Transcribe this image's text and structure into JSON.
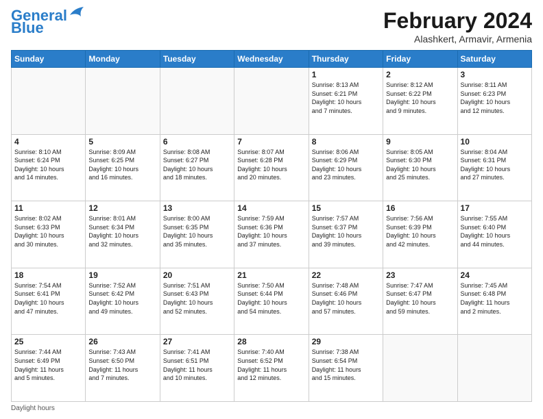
{
  "header": {
    "logo_line1": "General",
    "logo_line2": "Blue",
    "month_title": "February 2024",
    "location": "Alashkert, Armavir, Armenia"
  },
  "days_of_week": [
    "Sunday",
    "Monday",
    "Tuesday",
    "Wednesday",
    "Thursday",
    "Friday",
    "Saturday"
  ],
  "weeks": [
    [
      {
        "day": "",
        "info": ""
      },
      {
        "day": "",
        "info": ""
      },
      {
        "day": "",
        "info": ""
      },
      {
        "day": "",
        "info": ""
      },
      {
        "day": "1",
        "info": "Sunrise: 8:13 AM\nSunset: 6:21 PM\nDaylight: 10 hours\nand 7 minutes."
      },
      {
        "day": "2",
        "info": "Sunrise: 8:12 AM\nSunset: 6:22 PM\nDaylight: 10 hours\nand 9 minutes."
      },
      {
        "day": "3",
        "info": "Sunrise: 8:11 AM\nSunset: 6:23 PM\nDaylight: 10 hours\nand 12 minutes."
      }
    ],
    [
      {
        "day": "4",
        "info": "Sunrise: 8:10 AM\nSunset: 6:24 PM\nDaylight: 10 hours\nand 14 minutes."
      },
      {
        "day": "5",
        "info": "Sunrise: 8:09 AM\nSunset: 6:25 PM\nDaylight: 10 hours\nand 16 minutes."
      },
      {
        "day": "6",
        "info": "Sunrise: 8:08 AM\nSunset: 6:27 PM\nDaylight: 10 hours\nand 18 minutes."
      },
      {
        "day": "7",
        "info": "Sunrise: 8:07 AM\nSunset: 6:28 PM\nDaylight: 10 hours\nand 20 minutes."
      },
      {
        "day": "8",
        "info": "Sunrise: 8:06 AM\nSunset: 6:29 PM\nDaylight: 10 hours\nand 23 minutes."
      },
      {
        "day": "9",
        "info": "Sunrise: 8:05 AM\nSunset: 6:30 PM\nDaylight: 10 hours\nand 25 minutes."
      },
      {
        "day": "10",
        "info": "Sunrise: 8:04 AM\nSunset: 6:31 PM\nDaylight: 10 hours\nand 27 minutes."
      }
    ],
    [
      {
        "day": "11",
        "info": "Sunrise: 8:02 AM\nSunset: 6:33 PM\nDaylight: 10 hours\nand 30 minutes."
      },
      {
        "day": "12",
        "info": "Sunrise: 8:01 AM\nSunset: 6:34 PM\nDaylight: 10 hours\nand 32 minutes."
      },
      {
        "day": "13",
        "info": "Sunrise: 8:00 AM\nSunset: 6:35 PM\nDaylight: 10 hours\nand 35 minutes."
      },
      {
        "day": "14",
        "info": "Sunrise: 7:59 AM\nSunset: 6:36 PM\nDaylight: 10 hours\nand 37 minutes."
      },
      {
        "day": "15",
        "info": "Sunrise: 7:57 AM\nSunset: 6:37 PM\nDaylight: 10 hours\nand 39 minutes."
      },
      {
        "day": "16",
        "info": "Sunrise: 7:56 AM\nSunset: 6:39 PM\nDaylight: 10 hours\nand 42 minutes."
      },
      {
        "day": "17",
        "info": "Sunrise: 7:55 AM\nSunset: 6:40 PM\nDaylight: 10 hours\nand 44 minutes."
      }
    ],
    [
      {
        "day": "18",
        "info": "Sunrise: 7:54 AM\nSunset: 6:41 PM\nDaylight: 10 hours\nand 47 minutes."
      },
      {
        "day": "19",
        "info": "Sunrise: 7:52 AM\nSunset: 6:42 PM\nDaylight: 10 hours\nand 49 minutes."
      },
      {
        "day": "20",
        "info": "Sunrise: 7:51 AM\nSunset: 6:43 PM\nDaylight: 10 hours\nand 52 minutes."
      },
      {
        "day": "21",
        "info": "Sunrise: 7:50 AM\nSunset: 6:44 PM\nDaylight: 10 hours\nand 54 minutes."
      },
      {
        "day": "22",
        "info": "Sunrise: 7:48 AM\nSunset: 6:46 PM\nDaylight: 10 hours\nand 57 minutes."
      },
      {
        "day": "23",
        "info": "Sunrise: 7:47 AM\nSunset: 6:47 PM\nDaylight: 10 hours\nand 59 minutes."
      },
      {
        "day": "24",
        "info": "Sunrise: 7:45 AM\nSunset: 6:48 PM\nDaylight: 11 hours\nand 2 minutes."
      }
    ],
    [
      {
        "day": "25",
        "info": "Sunrise: 7:44 AM\nSunset: 6:49 PM\nDaylight: 11 hours\nand 5 minutes."
      },
      {
        "day": "26",
        "info": "Sunrise: 7:43 AM\nSunset: 6:50 PM\nDaylight: 11 hours\nand 7 minutes."
      },
      {
        "day": "27",
        "info": "Sunrise: 7:41 AM\nSunset: 6:51 PM\nDaylight: 11 hours\nand 10 minutes."
      },
      {
        "day": "28",
        "info": "Sunrise: 7:40 AM\nSunset: 6:52 PM\nDaylight: 11 hours\nand 12 minutes."
      },
      {
        "day": "29",
        "info": "Sunrise: 7:38 AM\nSunset: 6:54 PM\nDaylight: 11 hours\nand 15 minutes."
      },
      {
        "day": "",
        "info": ""
      },
      {
        "day": "",
        "info": ""
      }
    ]
  ],
  "footer": {
    "note": "Daylight hours"
  }
}
